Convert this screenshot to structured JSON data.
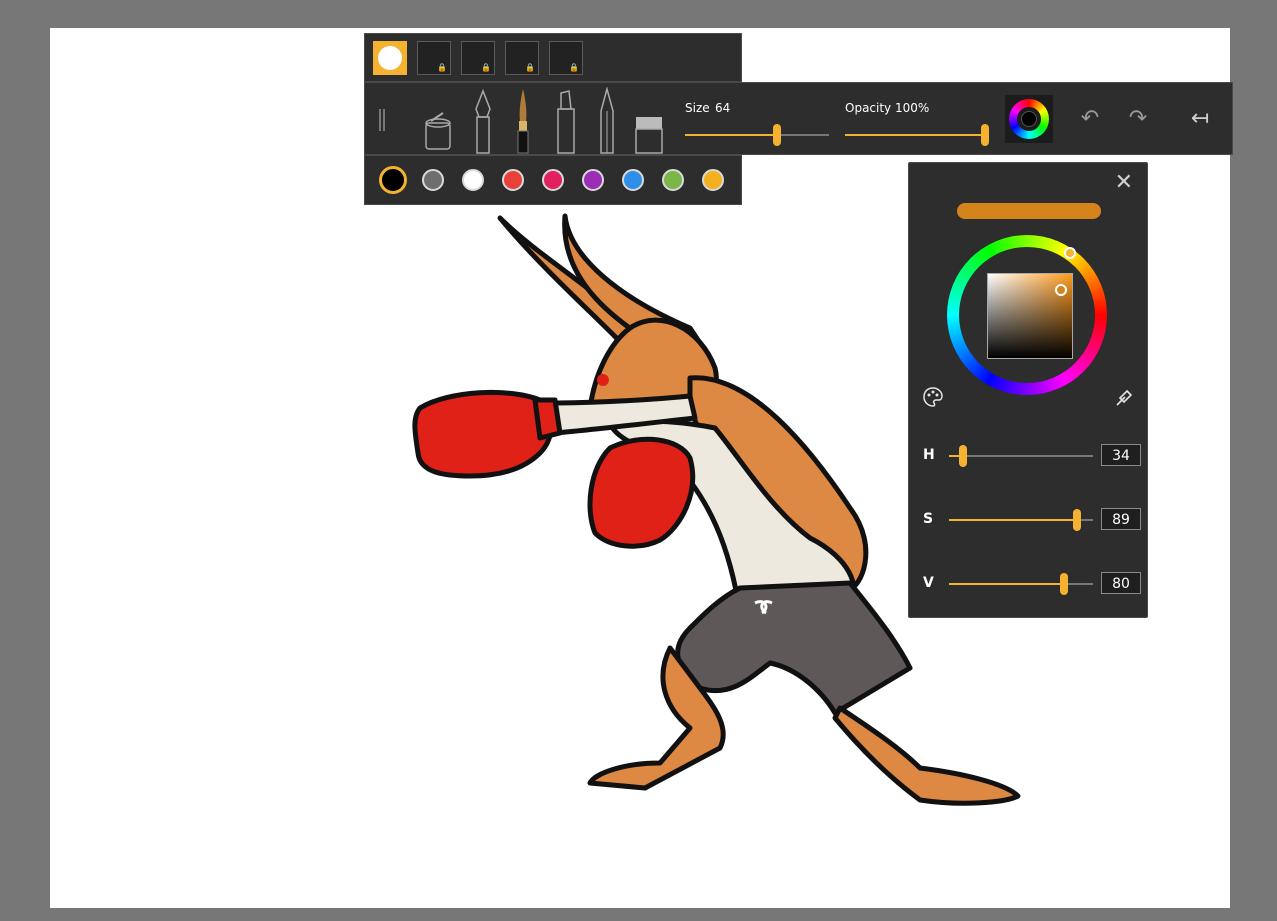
{
  "toolbar": {
    "presets": [
      {
        "name": "soft-round",
        "active": true,
        "locked": false
      },
      {
        "name": "preset-2",
        "active": false,
        "locked": true
      },
      {
        "name": "preset-3",
        "active": false,
        "locked": true
      },
      {
        "name": "preset-4",
        "active": false,
        "locked": true
      },
      {
        "name": "preset-5",
        "active": false,
        "locked": true
      }
    ],
    "tools": [
      "paint-bucket-icon",
      "fountain-pen-icon",
      "brush-icon",
      "marker-icon",
      "pencil-icon",
      "eraser-icon"
    ],
    "size_label": "Size",
    "size_value": "64",
    "size_level": 0.64,
    "opacity_label": "Opacity",
    "opacity_value": "100%",
    "opacity_level": 1.0,
    "undo_icon": "undo-icon",
    "redo_icon": "redo-icon",
    "collapse_icon": "collapse-left-icon"
  },
  "palette": {
    "colors": [
      "#000000",
      "#6e6e6e",
      "#ffffff",
      "#e8413a",
      "#e3205f",
      "#9a2eb4",
      "#2f8ee8",
      "#7ab648",
      "#f5b020"
    ],
    "selected_index": 0
  },
  "picker": {
    "close_icon": "close-icon",
    "current_color": "#d4841a",
    "palette_icon": "palette-icon",
    "eyedropper_icon": "eyedropper-icon",
    "h_label": "H",
    "h_value": "34",
    "h_level": 0.094,
    "s_label": "S",
    "s_value": "89",
    "s_level": 0.89,
    "v_label": "V",
    "v_value": "80",
    "v_level": 0.8
  },
  "colors": {
    "accent": "#f5b230",
    "panel": "#2d2d2d",
    "workspace": "#777777"
  }
}
